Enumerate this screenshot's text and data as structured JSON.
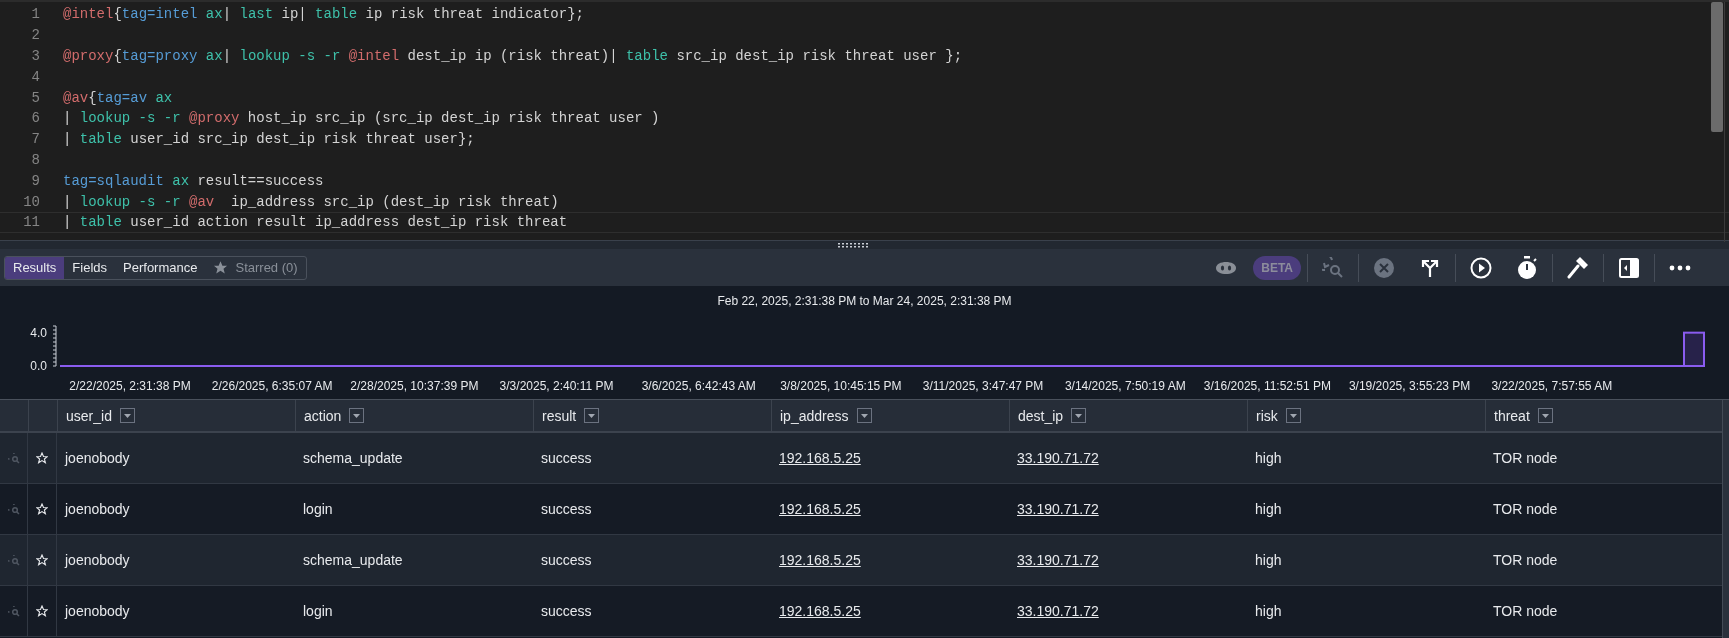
{
  "editor": {
    "lines": [
      {
        "number": "1",
        "current": false,
        "tokens": [
          {
            "text": "@intel",
            "kind": "macro"
          },
          {
            "text": "{",
            "kind": "plain"
          },
          {
            "text": "tag=intel",
            "kind": "tag"
          },
          {
            "text": " ax",
            "kind": "module"
          },
          {
            "text": "| ",
            "kind": "plain"
          },
          {
            "text": "last",
            "kind": "module"
          },
          {
            "text": " ip| ",
            "kind": "plain"
          },
          {
            "text": "table",
            "kind": "module"
          },
          {
            "text": " ip risk threat indicator};",
            "kind": "plain"
          }
        ]
      },
      {
        "number": "2",
        "current": false
      },
      {
        "number": "3",
        "current": false,
        "tokens": [
          {
            "text": "@proxy",
            "kind": "macro"
          },
          {
            "text": "{",
            "kind": "plain"
          },
          {
            "text": "tag=proxy",
            "kind": "tag"
          },
          {
            "text": " ax",
            "kind": "module"
          },
          {
            "text": "| ",
            "kind": "plain"
          },
          {
            "text": "lookup -s -r",
            "kind": "module"
          },
          {
            "text": " @intel",
            "kind": "macro"
          },
          {
            "text": " dest_ip ip (risk threat)| ",
            "kind": "plain"
          },
          {
            "text": "table",
            "kind": "module"
          },
          {
            "text": " src_ip dest_ip risk threat user };",
            "kind": "plain"
          }
        ]
      },
      {
        "number": "4",
        "current": false
      },
      {
        "number": "5",
        "current": false,
        "tokens": [
          {
            "text": "@av",
            "kind": "macro"
          },
          {
            "text": "{",
            "kind": "plain"
          },
          {
            "text": "tag=av",
            "kind": "tag"
          },
          {
            "text": " ax",
            "kind": "module"
          }
        ]
      },
      {
        "number": "6",
        "current": false,
        "tokens": [
          {
            "text": "| ",
            "kind": "plain"
          },
          {
            "text": "lookup -s -r",
            "kind": "module"
          },
          {
            "text": " @proxy",
            "kind": "macro"
          },
          {
            "text": " host_ip src_ip (src_ip dest_ip risk threat user )",
            "kind": "plain"
          }
        ]
      },
      {
        "number": "7",
        "current": false,
        "tokens": [
          {
            "text": "| ",
            "kind": "plain"
          },
          {
            "text": "table",
            "kind": "module"
          },
          {
            "text": " user_id src_ip dest_ip risk threat user};",
            "kind": "plain"
          }
        ]
      },
      {
        "number": "8",
        "current": false
      },
      {
        "number": "9",
        "current": false,
        "tokens": [
          {
            "text": "tag=sqlaudit",
            "kind": "tag"
          },
          {
            "text": " ax",
            "kind": "module"
          },
          {
            "text": " result==success",
            "kind": "plain"
          }
        ]
      },
      {
        "number": "10",
        "current": false,
        "tokens": [
          {
            "text": "| ",
            "kind": "plain"
          },
          {
            "text": "lookup -s -r",
            "kind": "module"
          },
          {
            "text": " @av",
            "kind": "macro"
          },
          {
            "text": "  ip_address src_ip (dest_ip risk threat)",
            "kind": "plain"
          }
        ]
      },
      {
        "number": "11",
        "current": true,
        "tokens": [
          {
            "text": "| ",
            "kind": "plain"
          },
          {
            "text": "table",
            "kind": "module"
          },
          {
            "text": " user_id action result ip_address dest_ip risk threat",
            "kind": "plain"
          }
        ]
      }
    ]
  },
  "tabs": [
    {
      "label": "Results",
      "kind": "tab",
      "selected": true,
      "disabled": false
    },
    {
      "label": "Fields",
      "kind": "tab",
      "selected": false,
      "disabled": false
    },
    {
      "label": "Performance",
      "kind": "tab",
      "selected": false,
      "disabled": false
    },
    {
      "label": "Starred (0)",
      "kind": "starred",
      "selected": false,
      "disabled": true
    }
  ],
  "toolbar": [
    {
      "kind": "assistant",
      "disabled": true,
      "divider_before": false
    },
    {
      "kind": "badge",
      "label": "BETA",
      "disabled": true,
      "divider_before": false
    },
    {
      "kind": "history",
      "disabled": true,
      "divider_before": true
    },
    {
      "kind": "cancel",
      "disabled": true,
      "divider_before": true
    },
    {
      "kind": "fork",
      "disabled": false,
      "divider_before": false
    },
    {
      "kind": "run",
      "disabled": false,
      "divider_before": true
    },
    {
      "kind": "timer",
      "disabled": false,
      "divider_before": false
    },
    {
      "kind": "hammer",
      "disabled": false,
      "divider_before": true
    },
    {
      "kind": "panel",
      "disabled": false,
      "divider_before": true
    },
    {
      "kind": "more",
      "disabled": false,
      "divider_before": true
    }
  ],
  "chart_data": {
    "type": "bar",
    "title": "Feb 22, 2025, 2:31:38 PM to Mar 24, 2025, 2:31:38 PM",
    "categories": [
      "2/22/2025, 2:31:38 PM",
      "2/26/2025, 6:35:07 AM",
      "2/28/2025, 10:37:39 PM",
      "3/3/2025, 2:40:11 PM",
      "3/6/2025, 6:42:43 AM",
      "3/8/2025, 10:45:15 PM",
      "3/11/2025, 3:47:47 PM",
      "3/14/2025, 7:50:19 AM",
      "3/16/2025, 11:52:51 PM",
      "3/19/2025, 3:55:23 PM",
      "3/22/2025, 7:57:55 AM",
      null
    ],
    "values": [
      null,
      null,
      null,
      null,
      null,
      null,
      null,
      null,
      null,
      null,
      null,
      4
    ],
    "ylim": [
      0,
      4.8
    ],
    "yticks": [
      {
        "value": 0,
        "label": "0.0"
      },
      {
        "value": 4,
        "label": "4.0"
      }
    ]
  },
  "table": {
    "columns": [
      {
        "name": "user_id",
        "kind": "text"
      },
      {
        "name": "action",
        "kind": "text"
      },
      {
        "name": "result",
        "kind": "text"
      },
      {
        "name": "ip_address",
        "kind": "link"
      },
      {
        "name": "dest_ip",
        "kind": "link"
      },
      {
        "name": "risk",
        "kind": "text"
      },
      {
        "name": "threat",
        "kind": "text"
      }
    ],
    "rows": [
      {
        "starred": false,
        "cells": [
          "joenobody",
          "schema_update",
          "success",
          "192.168.5.25",
          "33.190.71.72",
          "high",
          "TOR node"
        ]
      },
      {
        "starred": false,
        "cells": [
          "joenobody",
          "login",
          "success",
          "192.168.5.25",
          "33.190.71.72",
          "high",
          "TOR node"
        ]
      },
      {
        "starred": false,
        "cells": [
          "joenobody",
          "schema_update",
          "success",
          "192.168.5.25",
          "33.190.71.72",
          "high",
          "TOR node"
        ]
      },
      {
        "starred": false,
        "cells": [
          "joenobody",
          "login",
          "success",
          "192.168.5.25",
          "33.190.71.72",
          "high",
          "TOR node"
        ]
      }
    ]
  }
}
